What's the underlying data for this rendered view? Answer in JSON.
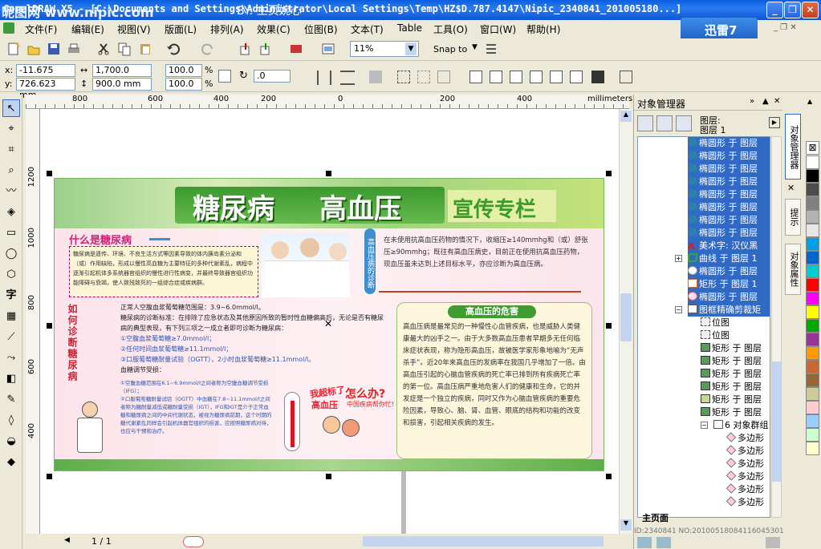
{
  "window": {
    "title": "CorelDRAW X5 - [C:\\Documents and Settings\\Administrator\\Local Settings\\Temp\\HZ$D.787.4147\\Nipic_2340841_201005180...]",
    "watermark_top": "昵图网 www.nipic.com",
    "watermark_by": "BY: 主页婉心",
    "min": "_",
    "max": "❐",
    "close": "✕"
  },
  "menu": {
    "items": [
      "文件(F)",
      "编辑(E)",
      "视图(V)",
      "版面(L)",
      "排列(A)",
      "效果(C)",
      "位图(B)",
      "文本(T)",
      "Table",
      "工具(O)",
      "窗口(W)",
      "帮助(H)"
    ],
    "promo": "迅雷7"
  },
  "toolbar": {
    "zoom": "11%",
    "snap": "Snap to"
  },
  "props": {
    "x_label": "x:",
    "x": "-11.675 mm",
    "y_label": "y:",
    "y": "726.623 mm",
    "w": "1,700.0 mm",
    "h": "900.0 mm",
    "sx": "100.0",
    "sy": "100.0",
    "pct": "%",
    "angle": ".0"
  },
  "ruler": {
    "units": "millimeters",
    "h_ticks": [
      "800",
      "600",
      "400",
      "200",
      "0",
      "200",
      "400"
    ],
    "v_ticks": [
      "1200",
      "1000",
      "800",
      "600",
      "400"
    ]
  },
  "poster": {
    "title1": "糖尿病",
    "title2": "高血压",
    "tag": "宣传专栏",
    "what_heading": "什么是糖尿病",
    "what_text": "糖尿病是遗传、环境、不良生活方式等因素导致的体内胰岛素分泌和（或）作用缺陷，形成以慢性高血糖为主要特征的多种代谢紊乱，病程中逐渐引起机体多系统器官组织的慢性进行性病变，并最终导致器官组织功能障碍与衰竭，使人致残致死的一组综合症或疾病群。",
    "how_heading": "如何诊断糖尿病",
    "diag_lines": [
      "正常人空腹血浆葡萄糖范围是：3.9~6.0mmol/l。",
      "糖尿病的诊断标准：在排除了应急状态及其他原因所致的暂时性血糖偏高后，无论是否有糖尿病的典型表现，有下列三项之一成立者即可诊断为糖尿病：",
      "①空腹血浆葡萄糖≥7.0mmol/l；",
      "②任何时间血浆葡萄糖≥11.1mmol/l；",
      "③口服葡萄糖耐量试验（OGTT），2小时血浆葡萄糖≥11.1mmol/l。",
      "血糖调节受损："
    ],
    "ifg_lines": [
      "①空腹血糖范围在6.1~6.9mmol/l之间者称为空腹血糖调节受损（IFG）；",
      "②口服葡萄糖耐量试验（OGTT）中血糖在7.8~11.1mmol/l之间者称为糖耐量减低或糖耐量受损（IGT），IFG和IGT是介于正常血糖和糖尿病之间的中间代谢状态，被视为糖尿病前期，这个时期的糖代谢紊乱同样会引起机体器官组织的损害，应按照糖尿病对待，也应与干预和治疗。"
    ],
    "bp_intro": "在未使用抗高血压药物的情况下，收缩压≥140mmhg和（或）舒张压≥90mmhg；既往有高血压病史，目前正在使用抗高血压药物，现血压虽未达到上述目标水平，亦应诊断为高血压病。",
    "bp_vertical": "高血压病的诊断",
    "harm_heading": "高血压的危害",
    "harm_text": "高血压病是最常见的一种慢性心血管疾病，也是威胁人类健康最大的凶手之一。由于大多数高血压患者早期多无任何临床症状表现，称为隐形高血压，故被医学家形象地喻为“无声杀手”。近20年来高血压的发病率在我国几乎增加了一倍。由高血压引起的心脑血管疾病的死亡率已排到所有疾病死亡率的第一位。高血压病严重地危害人们的健康和生命，它的并发症是一个独立的疾病，同时又作为心脑血管疾病的重要危险因素，导致心、脑、肾、血管、眼底的结构和功能的改变和损害，引起相关疾病的发生。",
    "bubble1": "我超标了",
    "bubble2": "高血压",
    "worry": "怎么办?",
    "worry_sub": "中国疾病帮你忙!"
  },
  "docker": {
    "title": "对象管理器",
    "layer_label": "图层:",
    "layer_name": "图层 1",
    "rows": [
      {
        "icon": "ellipse",
        "text": "椭圆形 于 图层",
        "sel": true
      },
      {
        "icon": "ellipse",
        "text": "椭圆形 于 图层",
        "sel": true
      },
      {
        "icon": "ellipse",
        "text": "椭圆形 于 图层",
        "sel": true
      },
      {
        "icon": "ellipse",
        "text": "椭圆形 于 图层",
        "sel": true
      },
      {
        "icon": "ellipse",
        "text": "椭圆形 于 图层",
        "sel": true
      },
      {
        "icon": "ellipse",
        "text": "椭圆形 于 图层",
        "sel": true
      },
      {
        "icon": "ellipse",
        "text": "椭圆形 于 图层",
        "sel": true
      },
      {
        "icon": "ellipse",
        "text": "椭圆形 于 图层",
        "sel": true
      },
      {
        "icon": "text",
        "text": "美术字: 汉仪黑",
        "sel": true
      },
      {
        "icon": "curve",
        "text": "曲线 于 图层 1",
        "sel": true
      },
      {
        "icon": "ellipse-w",
        "text": "椭圆形 于 图层",
        "sel": true
      },
      {
        "icon": "rect-o",
        "text": "矩形 于 图层 1",
        "sel": true
      },
      {
        "icon": "ellipse-p",
        "text": "椭圆形 于 图层",
        "sel": true
      },
      {
        "icon": "rect-w",
        "text": "图框精确剪裁矩",
        "sel": true
      },
      {
        "icon": "bitmap",
        "text": "位图",
        "sel": false
      },
      {
        "icon": "bitmap",
        "text": "位图",
        "sel": false
      },
      {
        "icon": "rect-g",
        "text": "矩形 于 图层",
        "sel": false
      },
      {
        "icon": "rect-g",
        "text": "矩形 于 图层",
        "sel": false
      },
      {
        "icon": "rect-g",
        "text": "矩形 于 图层",
        "sel": false
      },
      {
        "icon": "rect-g",
        "text": "矩形 于 图层",
        "sel": false
      },
      {
        "icon": "rect-y",
        "text": "矩形 于 图层",
        "sel": false
      },
      {
        "icon": "rect-g",
        "text": "矩形 于 图层",
        "sel": false
      },
      {
        "icon": "group",
        "text": "6 对象群组",
        "sel": false
      },
      {
        "icon": "poly",
        "text": "多边形",
        "sel": false
      },
      {
        "icon": "poly",
        "text": "多边形",
        "sel": false
      },
      {
        "icon": "poly",
        "text": "多边形",
        "sel": false
      },
      {
        "icon": "poly",
        "text": "多边形",
        "sel": false
      },
      {
        "icon": "poly",
        "text": "多边形",
        "sel": false
      },
      {
        "icon": "poly",
        "text": "多边形",
        "sel": false
      }
    ],
    "footer": "主页面",
    "id_text": "ID:2340841 NO:20100518084116045301"
  },
  "sidetabs": [
    "对象管理器",
    "提示",
    "对象属性"
  ],
  "status": {
    "page": "1 / 1"
  },
  "palette": [
    "#ffffff",
    "#000000",
    "#4d4d4d",
    "#808080",
    "#b3b3b3",
    "#e6e6e6",
    "#00a0e9",
    "#0066cc",
    "#00cccc",
    "#ff0000",
    "#ff00ff",
    "#ffff00",
    "#00aa00",
    "#993399",
    "#ff9900",
    "#cc6633",
    "#996633",
    "#cccc99",
    "#ffcccc",
    "#99ccff",
    "#ccffcc",
    "#ffffcc"
  ],
  "colors": {
    "selection": "#316ac5",
    "title_blue": "#0a5ee0",
    "poster_green": "#4ea83a"
  }
}
